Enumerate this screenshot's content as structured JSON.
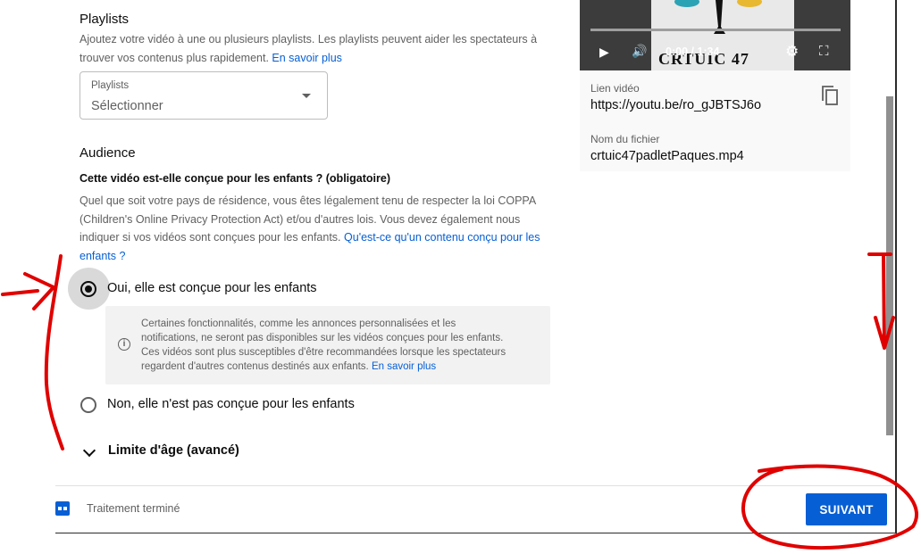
{
  "playlists": {
    "title": "Playlists",
    "desc_line1": "Ajoutez votre vidéo à une ou plusieurs playlists. Les playlists peuvent aider les spectateurs à",
    "desc_line2": "trouver vos contenus plus rapidement.",
    "learn_more": "En savoir plus",
    "select_label": "Playlists",
    "select_value": "Sélectionner"
  },
  "audience": {
    "title": "Audience",
    "question": "Cette vidéo est-elle conçue pour les enfants ? (obligatoire)",
    "desc_line1": "Quel que soit votre pays de résidence, vous êtes légalement tenu de respecter la loi COPPA",
    "desc_line2": "(Children's Online Privacy Protection Act) et/ou d'autres lois. Vous devez également nous",
    "desc_line3": "indiquer si vos vidéos sont conçues pour les enfants.",
    "link_line3": "Qu'est-ce qu'un contenu conçu pour les",
    "link_line4": "enfants ?",
    "option_yes": "Oui, elle est conçue pour les enfants",
    "option_no": "Non, elle n'est pas conçue pour les enfants",
    "selected": "yes",
    "info_line1": "Certaines fonctionnalités, comme les annonces personnalisées et les",
    "info_line2": "notifications, ne seront pas disponibles sur les vidéos conçues pour les enfants.",
    "info_line3": "Ces vidéos sont plus susceptibles d'être recommandées lorsque les spectateurs",
    "info_line4": "regardent d'autres contenus destinés aux enfants.",
    "info_link": "En savoir plus",
    "age_limit": "Limite d'âge (avancé)"
  },
  "video": {
    "time": "0:00 / 1:34",
    "overlay_text": "CRTUIC 47",
    "link_label": "Lien vidéo",
    "link_value": "https://youtu.be/ro_gJBTSJ6o",
    "file_label": "Nom du fichier",
    "file_value": "crtuic47padletPaques.mp4"
  },
  "footer": {
    "status": "Traitement terminé",
    "next_label": "SUIVANT"
  },
  "colors": {
    "accent": "#065fd4",
    "annotation": "#e00000"
  }
}
